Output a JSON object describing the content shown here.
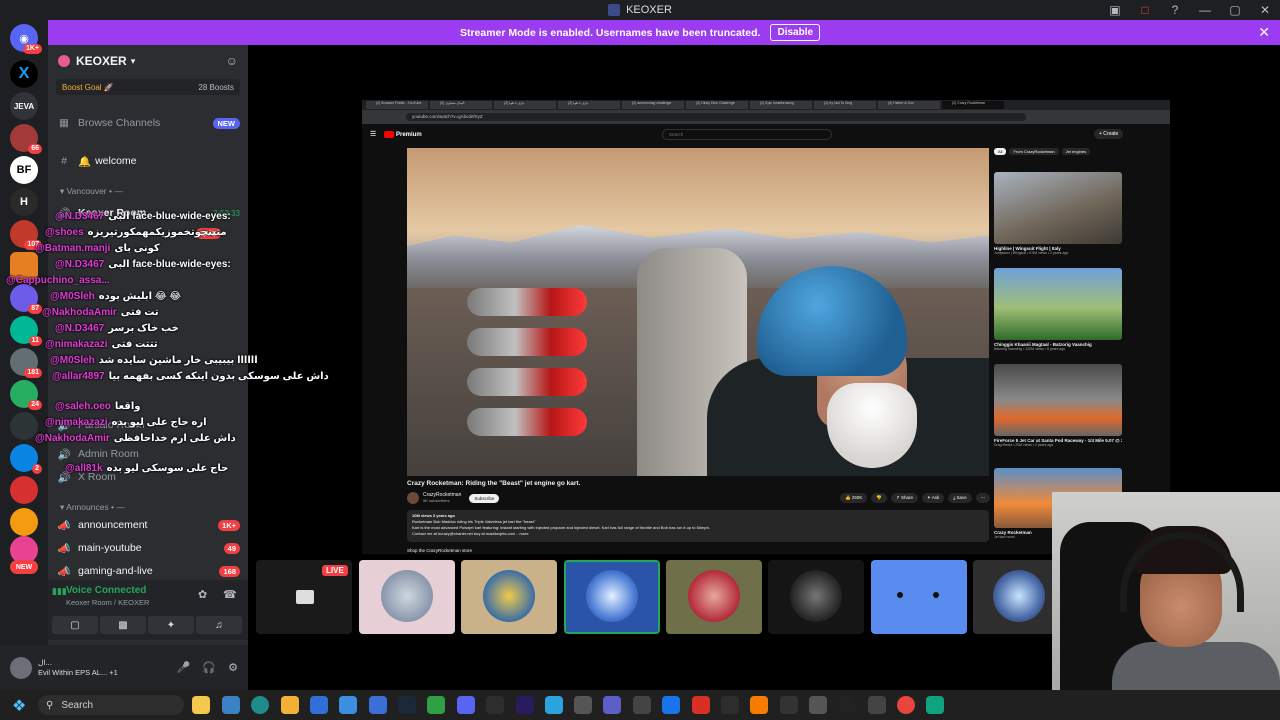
{
  "window": {
    "title": "KEOXER",
    "controls": [
      "▣",
      "□",
      "?",
      "—",
      "▢",
      "✕"
    ]
  },
  "banner": {
    "text": "Streamer Mode is enabled. Usernames have been truncated.",
    "button": "Disable",
    "close": "✕"
  },
  "rail": {
    "servers": [
      {
        "label": "1K+",
        "color": "#5865f2"
      },
      {
        "label": "X",
        "color": "#000000"
      },
      {
        "label": "JEVA",
        "color": "#313338"
      },
      {
        "label": "66",
        "color": "#a33a3a"
      },
      {
        "label": "BF",
        "color": "#ffffff"
      },
      {
        "label": "H",
        "color": "#2a2a2a"
      },
      {
        "label": "107",
        "color": "#c0392b"
      },
      {
        "label": "",
        "color": "#e67e22"
      },
      {
        "label": "87",
        "color": "#6c5ce7"
      },
      {
        "label": "11",
        "color": "#00b894"
      },
      {
        "label": "181",
        "color": "#636e72"
      },
      {
        "label": "24",
        "color": "#27ae60"
      },
      {
        "label": "",
        "color": "#2d3436"
      },
      {
        "label": "2",
        "color": "#0984e3"
      },
      {
        "label": "",
        "color": "#d63031"
      },
      {
        "label": "",
        "color": "#f39c12"
      },
      {
        "label": "",
        "color": "#e84393"
      },
      {
        "label": "NEW",
        "color": "#f23f43"
      }
    ]
  },
  "sidebar": {
    "guild_name": "KEOXER",
    "boost_goal": "Boost Goal 🚀",
    "boost_count": "28 Boosts",
    "browse": "Browse Channels",
    "browse_badge": "NEW",
    "welcome": "welcome",
    "cat_vancouver": "▾ Vancouver • —",
    "voice_room": "Keoxer Room",
    "voice_time": "2:53:33",
    "live_badge": "LIVE",
    "cat_announces": "▾ Announces • —",
    "channels": [
      {
        "name": "announcement",
        "count": "1K+"
      },
      {
        "name": "main-youtube",
        "count": "49"
      },
      {
        "name": "gaming-and-live",
        "count": "168"
      }
    ],
    "rooms": [
      "Parsalo Room",
      "Admin Room",
      "X Room"
    ]
  },
  "chat": [
    {
      "user": "@N.D3467",
      "msg": "البی face-blue-wide-eyes:"
    },
    {
      "user": "@shoes",
      "msg": "مثبتجوتخموزیکمهمکورتیریزه"
    },
    {
      "user": "@Batman.manji",
      "msg": "کونی بای"
    },
    {
      "user": "@N.D3467",
      "msg": "البی face-blue-wide-eyes:"
    },
    {
      "user": "@Cappuchino_assa...",
      "msg": ""
    },
    {
      "user": "@M0Sleh",
      "msg": "ابلیش بوده 😂 😂"
    },
    {
      "user": "@NakhodaAmir",
      "msg": "تت فتی"
    },
    {
      "user": "@N.D3467",
      "msg": "خب خاک برسر"
    },
    {
      "user": "@nimakazazi",
      "msg": "تتتت فتی"
    },
    {
      "user": "@M0Sleh",
      "msg": "اااااا بیبیبی خار ماشین سایده شد"
    },
    {
      "user": "@allar4897",
      "msg": "داش علی سوسکی بدون اینکه کسی بفهمه بیا"
    },
    {
      "user": "@saleh.oeo",
      "msg": "واقعا"
    },
    {
      "user": "@nimakazazi",
      "msg": "اره حاج علی لیو بده"
    },
    {
      "user": "@NakhodaAmir",
      "msg": "داش علی ارم خداحافظی"
    },
    {
      "user": "@all81k",
      "msg": "حاج علی سوسکی لیو بده"
    }
  ],
  "voice": {
    "status": "Voice Connected",
    "location": "Keoxer Room / KEOXER"
  },
  "user": {
    "name": "ال...",
    "activity": "Evil Within EPS AL... +1"
  },
  "youtube": {
    "tabs": [
      "(2) Browser Fiddle - YouTube",
      "(2) البیان مساوی",
      "(2) بازی با هوا",
      "(2) بازی با هوا",
      "(2) anonimmsg challenge",
      "(2) Dinky Dink Challenge",
      "(2) Epic Instathrowing",
      "(2) try Not To Sing",
      "(2) Father & Son",
      "(2) Crazy Rocketman"
    ],
    "url": "youtube.com/watch?v=gAbcdefXyZ",
    "search_placeholder": "Search",
    "premium": "Premium",
    "create": "+ Create",
    "video_title": "Crazy Rocketman: Riding the \"Beast\" jet engine go kart.",
    "channel": "CrazyRocketman",
    "subscribers": "5K subscribers",
    "subscribe": "Subscribe",
    "actions": [
      "👍 260K",
      "👎",
      "↱ Share",
      "✦ Ask",
      "⤓ Save",
      "⋯"
    ],
    "desc_line1": "10M views 3 years ago",
    "desc_line2": "Rocketman Bob Maddox riding his Triple Valveless jet kart the \"beast\"",
    "desc_line3": "Kart is the most advanced Pulsejet kart featuring: instant starting with injected propane and injected diesel. Kart has full range of throttle and Bob has run it up to 60mph.",
    "desc_line4": "Contact me at bcrazy@charter.net buy at maddoxjets.com ...more",
    "store": "Shop the CrazyRocketman store",
    "chips": [
      "All",
      "From CrazyRocketman",
      "Jet engines"
    ],
    "suggestions": [
      {
        "title": "Highline | Wingsuit Flight | Italy",
        "meta": "Jumpworx | Wingsuit • 9.5M views • 2 years ago"
      },
      {
        "title": "Chinggis Khaanii Magtaal - Batzorig Vaanchig",
        "meta": "Batzorig Vaanchig • 120M views • 5 years ago"
      },
      {
        "title": "FireForce 5 Jet Car at Santa Pod Raceway - 1/4 Mile 5.07 @ 279mph",
        "meta": "Drag Media • 20M views • 2 years ago"
      },
      {
        "title": "Crazy Rocketman",
        "meta": "Jet kart novel"
      }
    ]
  },
  "strip": {
    "live": "LIVE"
  },
  "taskbar": {
    "search": "Search"
  }
}
